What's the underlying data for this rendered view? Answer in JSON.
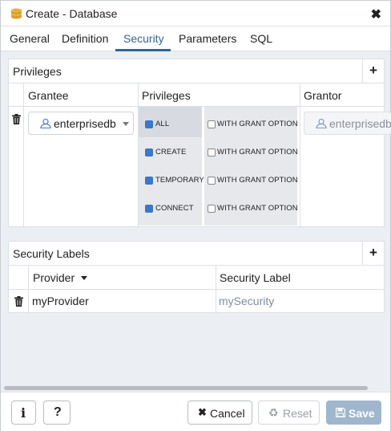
{
  "dialog": {
    "title": "Create - Database",
    "title_icon": "database-icon",
    "close_icon": "close-icon"
  },
  "tabs": [
    {
      "label": "General"
    },
    {
      "label": "Definition"
    },
    {
      "label": "Security",
      "active": true
    },
    {
      "label": "Parameters"
    },
    {
      "label": "SQL"
    }
  ],
  "privileges_panel": {
    "title": "Privileges",
    "add_label": "+",
    "columns": {
      "grantee": "Grantee",
      "privileges": "Privileges",
      "grantor": "Grantor"
    },
    "row": {
      "grantee": "enterprisedb",
      "grantor": "enterprisedb",
      "privileges": [
        {
          "name": "ALL",
          "checked": true,
          "grant_option_label": "WITH GRANT OPTION",
          "grant_option": false
        },
        {
          "name": "CREATE",
          "checked": true,
          "grant_option_label": "WITH GRANT OPTION",
          "grant_option": false
        },
        {
          "name": "TEMPORARY",
          "checked": true,
          "grant_option_label": "WITH GRANT OPTION",
          "grant_option": false
        },
        {
          "name": "CONNECT",
          "checked": true,
          "grant_option_label": "WITH GRANT OPTION",
          "grant_option": false
        }
      ]
    }
  },
  "security_labels_panel": {
    "title": "Security Labels",
    "add_label": "+",
    "columns": {
      "provider": "Provider",
      "security_label": "Security Label"
    },
    "rows": [
      {
        "provider": "myProvider",
        "security_label": "mySecurity"
      }
    ]
  },
  "footer": {
    "info_label": "i",
    "help_label": "?",
    "cancel_label": "Cancel",
    "reset_label": "Reset",
    "save_label": "Save"
  },
  "colors": {
    "accent": "#326690",
    "checkbox": "#3a78c8",
    "save_bg": "#9fb6cd",
    "muted_text": "#8a9099"
  }
}
